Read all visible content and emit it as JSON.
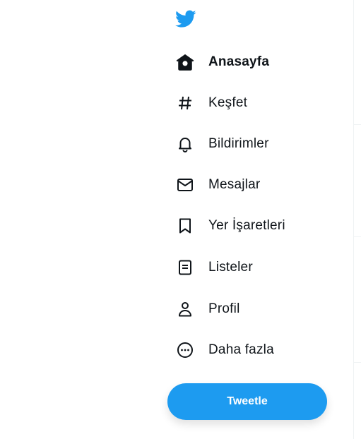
{
  "logo": {
    "icon": "twitter-bird-icon",
    "color": "#1d9bf0"
  },
  "nav": {
    "items": [
      {
        "id": "home",
        "label": "Anasayfa",
        "icon": "home-icon",
        "active": true
      },
      {
        "id": "explore",
        "label": "Keşfet",
        "icon": "hashtag-icon",
        "active": false
      },
      {
        "id": "notifications",
        "label": "Bildirimler",
        "icon": "bell-icon",
        "active": false
      },
      {
        "id": "messages",
        "label": "Mesajlar",
        "icon": "envelope-icon",
        "active": false
      },
      {
        "id": "bookmarks",
        "label": "Yer İşaretleri",
        "icon": "bookmark-icon",
        "active": false
      },
      {
        "id": "lists",
        "label": "Listeler",
        "icon": "list-icon",
        "active": false
      },
      {
        "id": "profile",
        "label": "Profil",
        "icon": "person-icon",
        "active": false
      },
      {
        "id": "more",
        "label": "Daha fazla",
        "icon": "more-circle-icon",
        "active": false
      }
    ]
  },
  "tweet_button": {
    "label": "Tweetle",
    "color": "#1d9bf0"
  }
}
